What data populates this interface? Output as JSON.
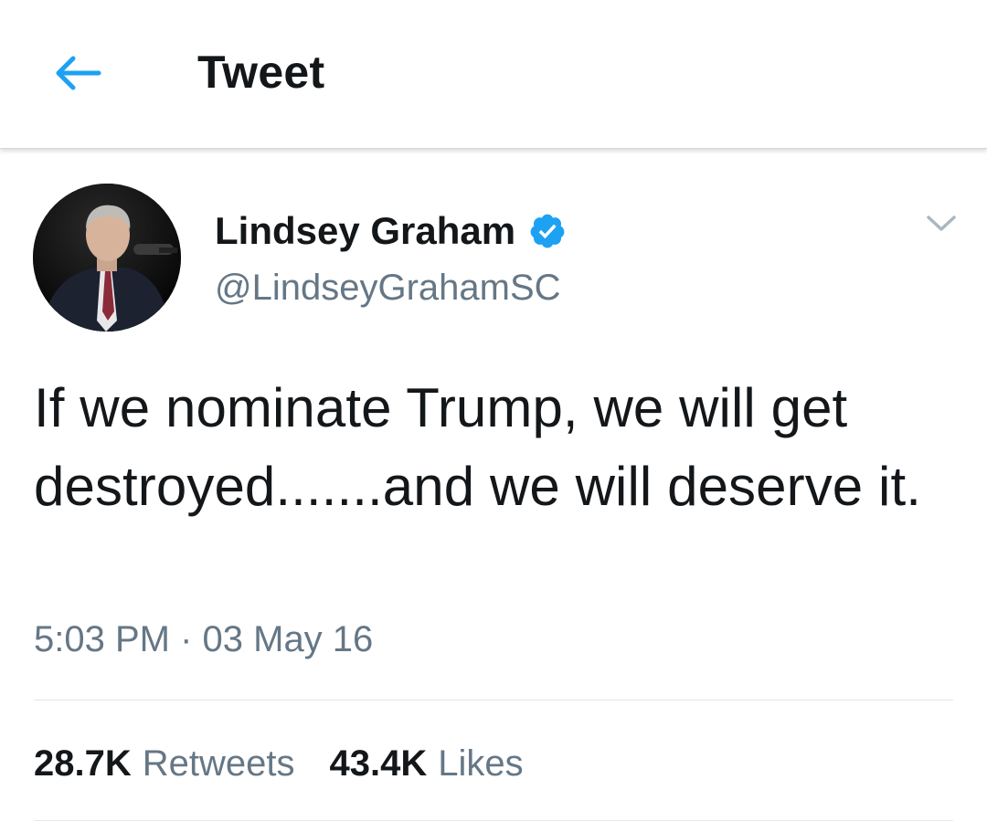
{
  "header": {
    "title": "Tweet",
    "back_icon": "arrow-left-icon"
  },
  "colors": {
    "accent": "#1da1f2",
    "text_primary": "#14171a",
    "text_secondary": "#657786",
    "divider": "#e1e8ed"
  },
  "author": {
    "display_name": "Lindsey Graham",
    "handle": "@LindseyGrahamSC",
    "verified_icon": "verified-badge-icon",
    "avatar_icon": "avatar"
  },
  "menu_icon": "chevron-down-icon",
  "tweet": {
    "text": "If we nominate Trump, we will get destroyed.......and we will deserve it.",
    "timestamp": "5:03 PM · 03 May 16"
  },
  "stats": {
    "retweets_count": "28.7K",
    "retweets_label": "Retweets",
    "likes_count": "43.4K",
    "likes_label": "Likes"
  }
}
